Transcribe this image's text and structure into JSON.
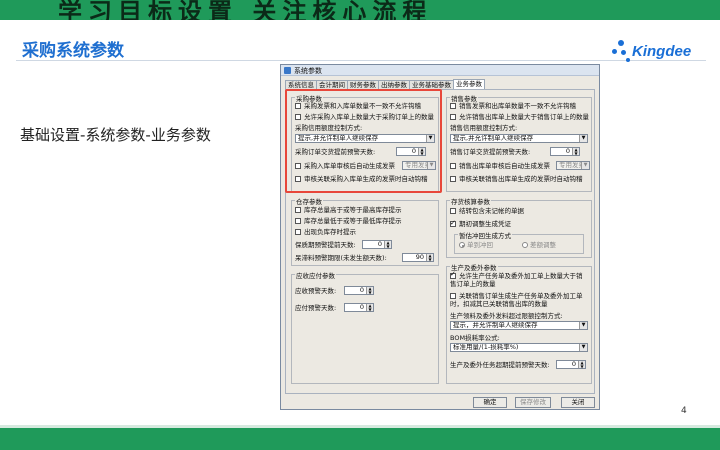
{
  "slide": {
    "top_band_title": "学习目标设置 关注核心流程",
    "title": "采购系统参数",
    "body": "基础设置-系统参数-业务参数",
    "page_number": "4",
    "logo_text": "Kingdee",
    "colors": {
      "band": "#1f9a5a",
      "title": "#1f6fd0",
      "highlight": "#e8473a",
      "logo": "#1a6fd6"
    }
  },
  "dialog": {
    "title": "系统参数",
    "tabs": [
      "系统信息",
      "会计期间",
      "财务参数",
      "出纳参数",
      "业务基础参数",
      "业务参数"
    ],
    "active_tab": "业务参数",
    "purchase": {
      "label": "采购参数",
      "opt1": "采购发票和入库单数量不一致不允许钩稽",
      "opt2": "允许采购入库单上数量大于采购订单上的数量",
      "credit_label": "采购信用额度控制方式:",
      "credit_value": "提示,并允许制单人继续保存",
      "warn_label": "采购订单交货提前预警天数:",
      "warn_value": "0",
      "invoice_opt": "采购入库单审核后自动生成发票",
      "invoice_type": "专用发票",
      "link_opt": "审核关联采购入库单生成的发票时自动钩稽"
    },
    "sales": {
      "label": "销售参数",
      "opt1": "销售发票和出库单数量不一致不允许钩稽",
      "opt2": "允许销售出库单上数量大于销售订单上的数量",
      "credit_label": "销售信用额度控制方式:",
      "credit_value": "提示,并允许制单人继续保存",
      "warn_label": "销售订单交货提前预警天数:",
      "warn_value": "0",
      "invoice_opt": "销售出库单审核后自动生成发票",
      "invoice_type": "专用发票",
      "link_opt": "审核关联销售出库单生成的发票时自动钩稽"
    },
    "inventory": {
      "label": "仓存参数",
      "opt1": "库存总量高于或等于最高库存提示",
      "opt2": "库存总量低于或等于最低库存提示",
      "opt3": "出现负库存时提示",
      "shelf_label": "保质期预警提前天数:",
      "shelf_value": "0",
      "stagnant_label": "呆滞料预警期限(未发生额天数):",
      "stagnant_value": "90"
    },
    "ar_ap": {
      "label": "应收应付参数",
      "ar_label": "应收预警天数:",
      "ar_value": "0",
      "ap_label": "应付预警天数:",
      "ap_value": "0"
    },
    "costing": {
      "label": "存货核算参数",
      "opt1": "结转包含未记帐的单据",
      "opt2": "期初调整生成凭证",
      "sub_label": "暂估冲回生成方式",
      "radio1": "单到冲回",
      "radio2": "差额调整"
    },
    "production": {
      "label": "生产及委外参数",
      "opt1": "允许生产任务单及委外加工单上数量大于销售订单上的数量",
      "opt2": "关联销售订单生成生产任务单及委外加工单时，扣减其已关联销售出库的数量",
      "ctrl_label": "生产领料及委外发料超过限额控制方式:",
      "ctrl_value": "提示，并允许制单人继续保存",
      "bom_label": "BOM损耗率公式:",
      "bom_value": "标准用量/(1-损耗率%)",
      "warn_label": "生产及委外任务超期提前预警天数:",
      "warn_value": "0"
    },
    "buttons": {
      "ok": "确定",
      "save": "保存修改",
      "close": "关闭"
    }
  }
}
